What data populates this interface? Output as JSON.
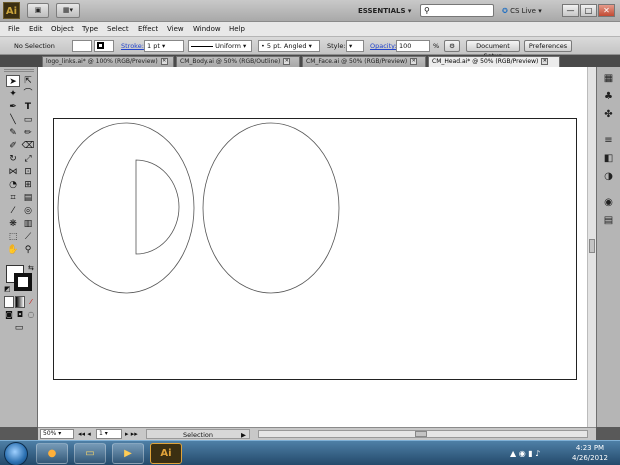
{
  "app": {
    "logo": "Ai",
    "workspace": "ESSENTIALS",
    "cslive": "CS Live",
    "window_buttons": [
      "—",
      "□",
      "✕"
    ]
  },
  "menu": [
    "File",
    "Edit",
    "Object",
    "Type",
    "Select",
    "Effect",
    "View",
    "Window",
    "Help"
  ],
  "control": {
    "selection": "No Selection",
    "stroke_label": "Stroke:",
    "stroke_value": "1 pt",
    "profile": "Uniform",
    "brush": "5 pt. Angled",
    "style_label": "Style:",
    "opacity_label": "Opacity:",
    "opacity_value": "100",
    "percent": "%",
    "doc_setup": "Document Setup",
    "preferences": "Preferences"
  },
  "tabs": [
    {
      "label": "logo_links.ai* @ 100% (RGB/Preview)",
      "active": false
    },
    {
      "label": "CM_Body.ai @ 50% (RGB/Outline)",
      "active": false
    },
    {
      "label": "CM_Face.ai @ 50% (RGB/Preview)",
      "active": false
    },
    {
      "label": "CM_Head.ai* @ 50% (RGB/Preview)",
      "active": true
    }
  ],
  "status": {
    "zoom": "50%",
    "page": "1",
    "tool": "Selection"
  },
  "taskbar": {
    "time": "4:23 PM",
    "date": "4/26/2012",
    "apps": [
      "IE",
      "Firefox",
      "Explorer",
      "Media",
      "Ai"
    ]
  },
  "colors": {
    "artboard_border": "#222222",
    "shape_stroke": "#555555",
    "link_blue": "#2244cc"
  }
}
